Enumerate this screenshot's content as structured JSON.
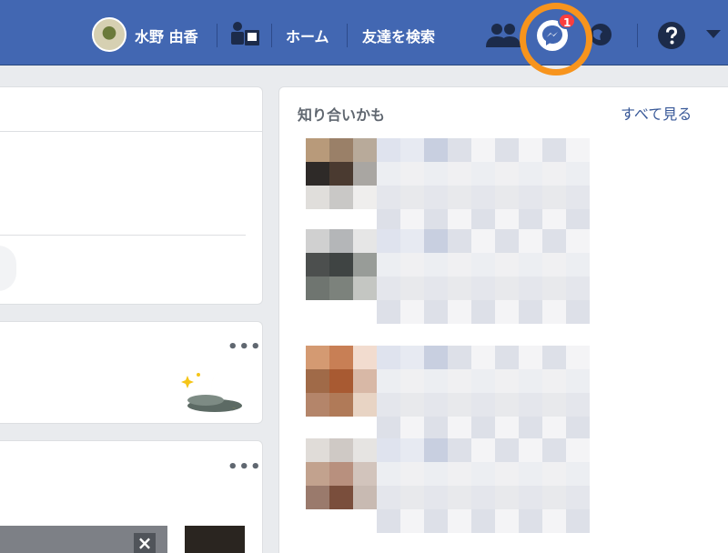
{
  "topbar": {
    "user_name": "水野 由香",
    "home": "ホーム",
    "find_friends": "友達を検索",
    "messages_badge": "1"
  },
  "suggestions": {
    "title": "知り合いかも",
    "see_all": "すべて見る"
  },
  "colors": {
    "brand": "#4267b2",
    "badge": "#fa3e3e",
    "highlight": "#f7941d"
  }
}
